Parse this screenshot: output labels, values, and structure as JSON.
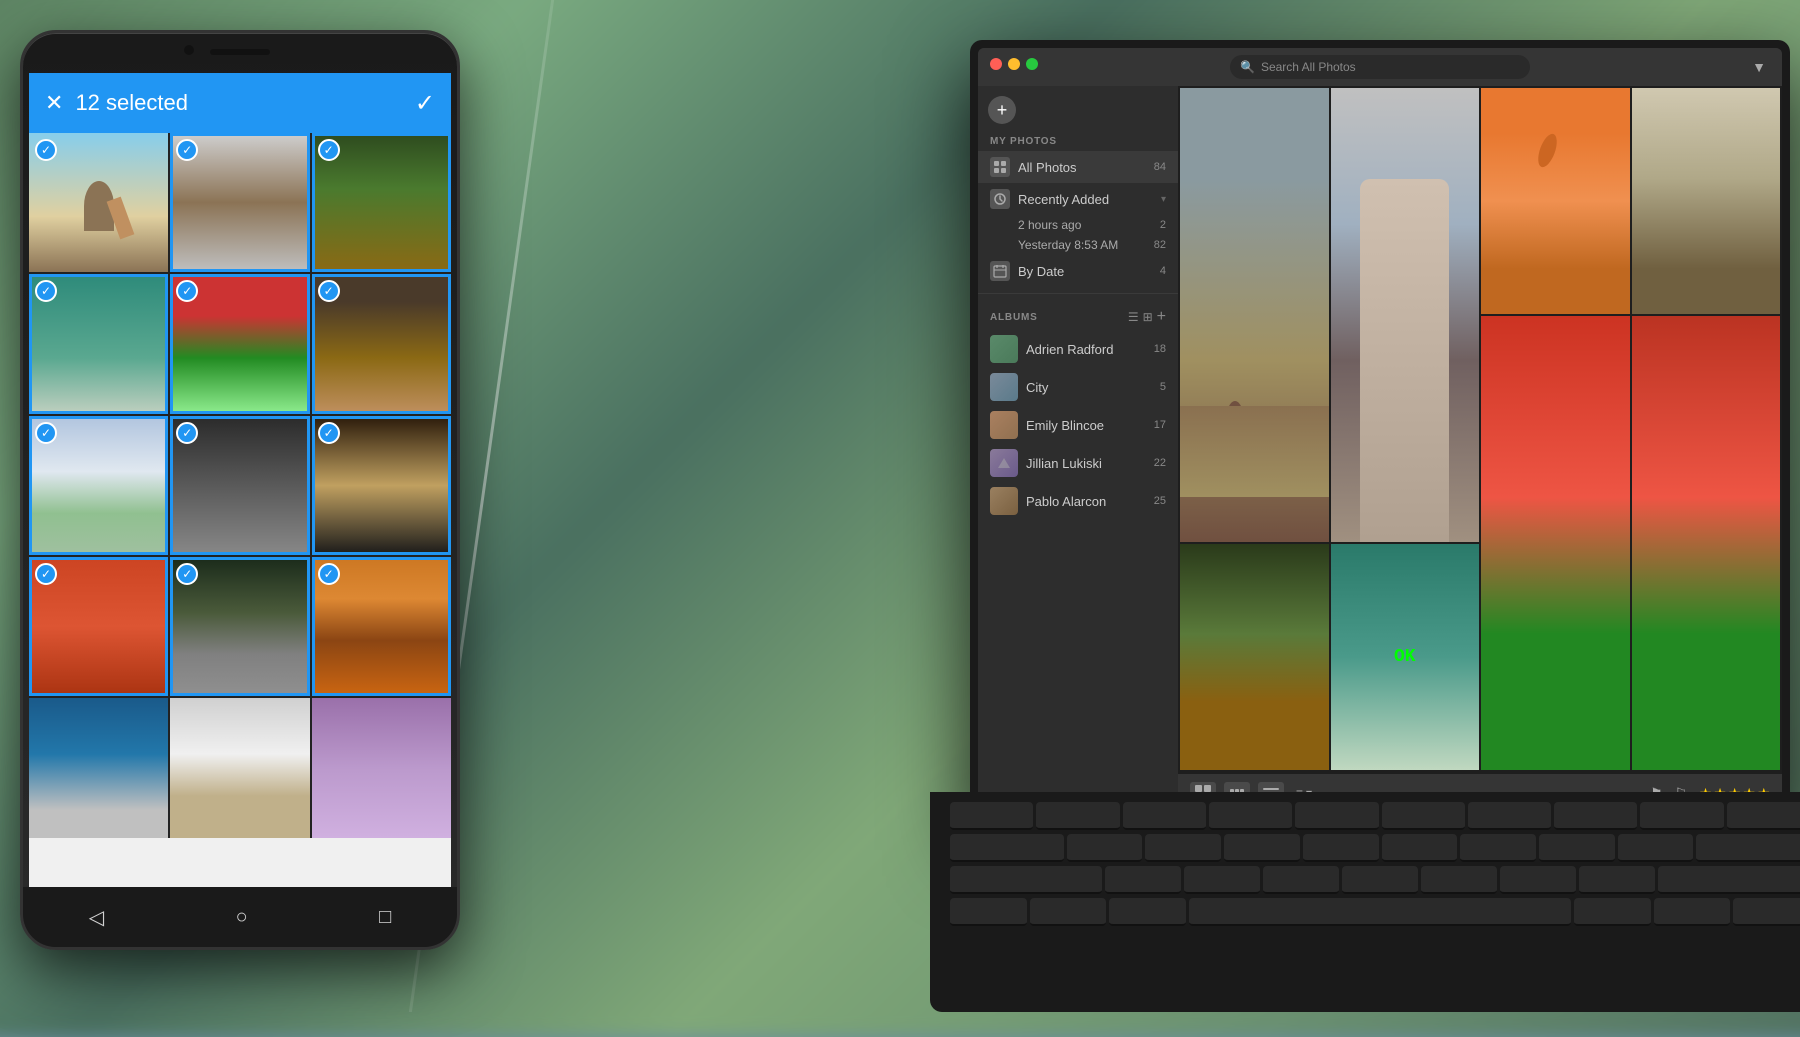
{
  "phone": {
    "selected_count": "12 selected",
    "close_icon": "✕",
    "check_icon": "✓",
    "nav_buttons": [
      "◁",
      "○",
      "□"
    ],
    "grid_cells": [
      {
        "id": 1,
        "selected": true,
        "color": "color-sky"
      },
      {
        "id": 2,
        "selected": true,
        "color": "color-urban"
      },
      {
        "id": 3,
        "selected": true,
        "color": "color-food"
      },
      {
        "id": 4,
        "selected": true,
        "color": "color-teal"
      },
      {
        "id": 5,
        "selected": true,
        "color": "color-red-person"
      },
      {
        "id": 6,
        "selected": true,
        "color": "color-workshop"
      },
      {
        "id": 7,
        "selected": true,
        "color": "color-cloud"
      },
      {
        "id": 8,
        "selected": true,
        "color": "color-portrait"
      },
      {
        "id": 9,
        "selected": true,
        "color": "color-circle"
      },
      {
        "id": 10,
        "selected": true,
        "color": "color-door"
      },
      {
        "id": 11,
        "selected": true,
        "color": "color-road"
      },
      {
        "id": 12,
        "selected": true,
        "color": "color-autumn"
      },
      {
        "id": 13,
        "selected": false,
        "color": "color-graffiti"
      },
      {
        "id": 14,
        "selected": false,
        "color": "color-dog"
      },
      {
        "id": 15,
        "selected": false,
        "color": "color-purple"
      }
    ]
  },
  "laptop": {
    "toolbar": {
      "search_placeholder": "Search All Photos",
      "filter_icon": "▼"
    },
    "sidebar": {
      "my_photos_label": "MY PHOTOS",
      "add_icon": "+",
      "all_photos": {
        "label": "All Photos",
        "count": "84"
      },
      "recently_added": {
        "label": "Recently Added",
        "arrow": "▾",
        "sub_items": [
          {
            "label": "2 hours ago",
            "count": "2"
          },
          {
            "label": "Yesterday 8:53 AM",
            "count": "82"
          }
        ]
      },
      "by_date": {
        "label": "By Date",
        "count": "4"
      },
      "albums_label": "ALBUMS",
      "albums_list_icon": "☰",
      "albums_grid_icon": "⊞",
      "albums_add_icon": "+",
      "albums": [
        {
          "label": "Adrien Radford",
          "count": "18",
          "color": "#6a8a7a"
        },
        {
          "label": "City",
          "count": "5",
          "color": "#7a8a9a"
        },
        {
          "label": "Emily Blincoe",
          "count": "17",
          "color": "#aa8870"
        },
        {
          "label": "Jillian Lukiski",
          "count": "22",
          "color": "#8a7a9a"
        },
        {
          "label": "Pablo Alarcon",
          "count": "25",
          "color": "#9a8870"
        }
      ]
    },
    "photos": {
      "cells": [
        {
          "id": 1,
          "color": "pc-street",
          "span_row": 2,
          "span_col": 1
        },
        {
          "id": 2,
          "color": "pc-woman",
          "span_row": 2,
          "span_col": 1
        },
        {
          "id": 3,
          "color": "pc-jump",
          "span_row": 1,
          "span_col": 1
        },
        {
          "id": 4,
          "color": "pc-group",
          "span_row": 1,
          "span_col": 1
        },
        {
          "id": 5,
          "color": "pc-food2",
          "span_row": 1,
          "span_col": 1
        },
        {
          "id": 6,
          "color": "pc-teal2",
          "span_row": 1,
          "span_col": 1,
          "has_ok": true
        },
        {
          "id": 7,
          "color": "pc-red2",
          "span_row": 1,
          "span_col": 1
        },
        {
          "id": 8,
          "color": "pc-ok",
          "span_row": 1,
          "span_col": 1
        },
        {
          "id": 9,
          "color": "pc-cloud2",
          "span_row": 1,
          "span_col": 1
        },
        {
          "id": 10,
          "color": "pc-portrait2",
          "span_row": 1,
          "span_col": 1
        },
        {
          "id": 11,
          "color": "pc-circle2",
          "span_row": 1,
          "span_col": 1
        },
        {
          "id": 12,
          "color": "pc-green",
          "span_row": 1,
          "span_col": 1
        }
      ]
    },
    "bottom_bar": {
      "stars": [
        "★",
        "★",
        "★",
        "★",
        "★"
      ],
      "flag_icon": "⚑",
      "sort_label": "≡ ▾"
    },
    "traffic_lights": {
      "red": "#ff5f56",
      "yellow": "#ffbd2e",
      "green": "#27c93f"
    }
  }
}
